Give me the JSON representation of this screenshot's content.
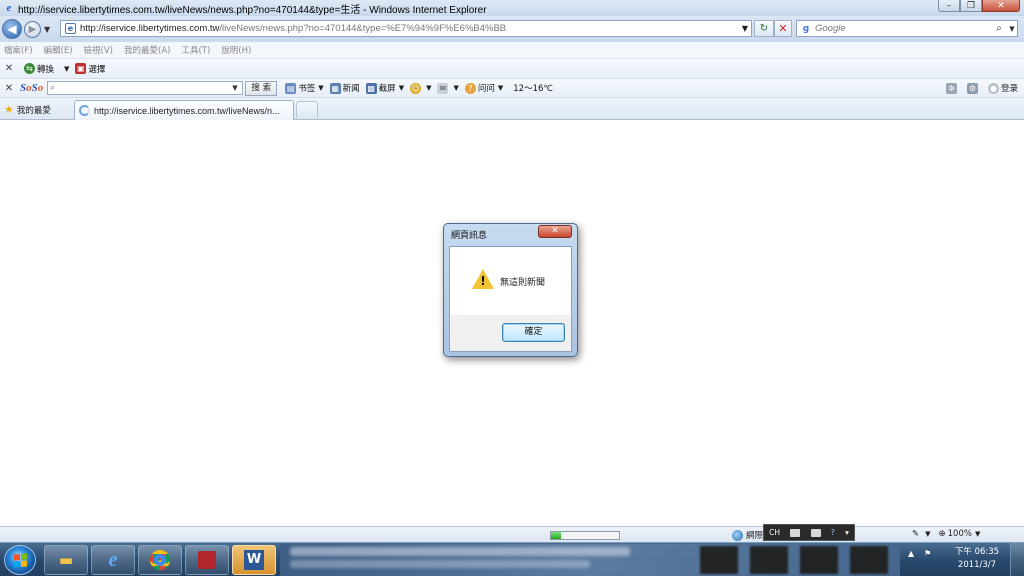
{
  "window": {
    "title": "http://iservice.libertytimes.com.tw/liveNews/news.php?no=470144&type=生活 - Windows Internet Explorer",
    "min_label": "–",
    "max_label": "❐",
    "close_label": "✕"
  },
  "navbar": {
    "url_host": "http://iservice.libertytimes.com.tw",
    "url_path": "/liveNews/news.php?no=470144&type=%E7%94%9F%E6%B4%BB",
    "search_placeholder": "Google"
  },
  "menu": [
    "檔案(F)",
    "編輯(E)",
    "檢視(V)",
    "我的最愛(A)",
    "工具(T)",
    "說明(H)"
  ],
  "toolbar1": {
    "convert_label": "轉換",
    "select_label": "選擇"
  },
  "toolbar2": {
    "search_button": "搜 索",
    "bookmarks_label": "书签",
    "news_label": "新闻",
    "screenshot_label": "截屏",
    "ask_label": "问问",
    "weather": "12～16℃",
    "login_label": "登录"
  },
  "favbar": {
    "favorites_label": "我的最愛",
    "tab_title": "http://iservice.libertytimes.com.tw/liveNews/n..."
  },
  "statusbar": {
    "progress_fraction": 0.15,
    "zone_text": "網際",
    "lang": "CH",
    "zoom": "100%"
  },
  "dialog": {
    "title": "網頁訊息",
    "message": "無這則新聞",
    "ok_label": "確定"
  },
  "taskbar": {
    "time": "下午 06:35",
    "date": "2011/3/7"
  }
}
